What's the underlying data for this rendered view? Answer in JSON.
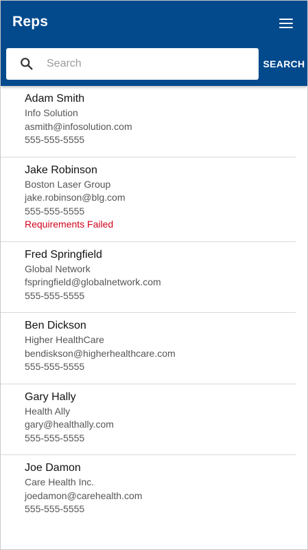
{
  "header": {
    "title": "Reps",
    "menu_icon": "hamburger-menu-icon",
    "background_color": "#034a8d"
  },
  "search": {
    "placeholder": "Search",
    "value": "",
    "button_label": "SEARCH",
    "icon": "search-icon"
  },
  "reps": [
    {
      "name": "Adam Smith",
      "company": "Info Solution",
      "email": "asmith@infosolution.com",
      "phone": "555-555-5555"
    },
    {
      "name": "Jake Robinson",
      "company": "Boston Laser Group",
      "email": "jake.robinson@blg.com",
      "phone": "555-555-5555",
      "warning": "Requirements Failed"
    },
    {
      "name": "Fred Springfield",
      "company": "Global Network",
      "email": "fspringfield@globalnetwork.com",
      "phone": "555-555-5555"
    },
    {
      "name": "Ben Dickson",
      "company": "Higher HealthCare",
      "email": "bendiskson@higherhealthcare.com",
      "phone": "555-555-5555"
    },
    {
      "name": "Gary Hally",
      "company": "Health Ally",
      "email": "gary@healthally.com",
      "phone": "555-555-5555"
    },
    {
      "name": "Joe Damon",
      "company": "Care Health Inc.",
      "email": "joedamon@carehealth.com",
      "phone": "555-555-5555"
    }
  ],
  "colors": {
    "warning": "#d0021b"
  }
}
